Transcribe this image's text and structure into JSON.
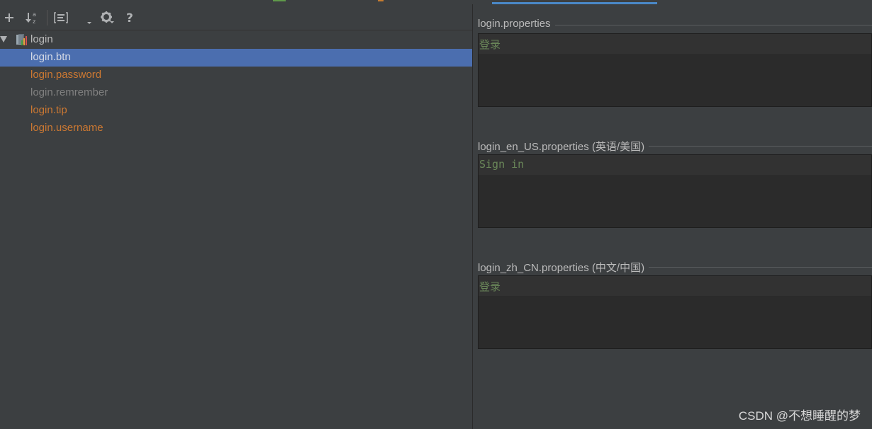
{
  "tree": {
    "root": "login",
    "keys": [
      {
        "label": "login.btn",
        "state": "selected",
        "color": "#d6dbe6"
      },
      {
        "label": "login.password",
        "state": "normal",
        "color": "#cc7832"
      },
      {
        "label": "login.remrember",
        "state": "normal",
        "color": "#808080"
      },
      {
        "label": "login.tip",
        "state": "normal",
        "color": "#cc7832"
      },
      {
        "label": "login.username",
        "state": "normal",
        "color": "#cc7832"
      }
    ]
  },
  "toolbar": {
    "icons": [
      "add-icon",
      "sort-alphabetically-icon",
      "group-by-prefix-icon",
      "dropdown-arrow-icon",
      "gear-icon",
      "help-icon"
    ]
  },
  "editors": [
    {
      "file": "login.properties",
      "locale": "",
      "value": "登录"
    },
    {
      "file": "login_en_US.properties",
      "locale": "(英语/美国)",
      "value": "Sign in"
    },
    {
      "file": "login_zh_CN.properties",
      "locale": "(中文/中国)",
      "value": "登录"
    }
  ],
  "watermark": "CSDN @不想睡醒的梦",
  "colors": {
    "accent_tab": "#4a88c7",
    "selection": "#4b6eaf",
    "string_value": "#6a8759",
    "modified_key": "#cc7832",
    "unused_key": "#808080"
  }
}
